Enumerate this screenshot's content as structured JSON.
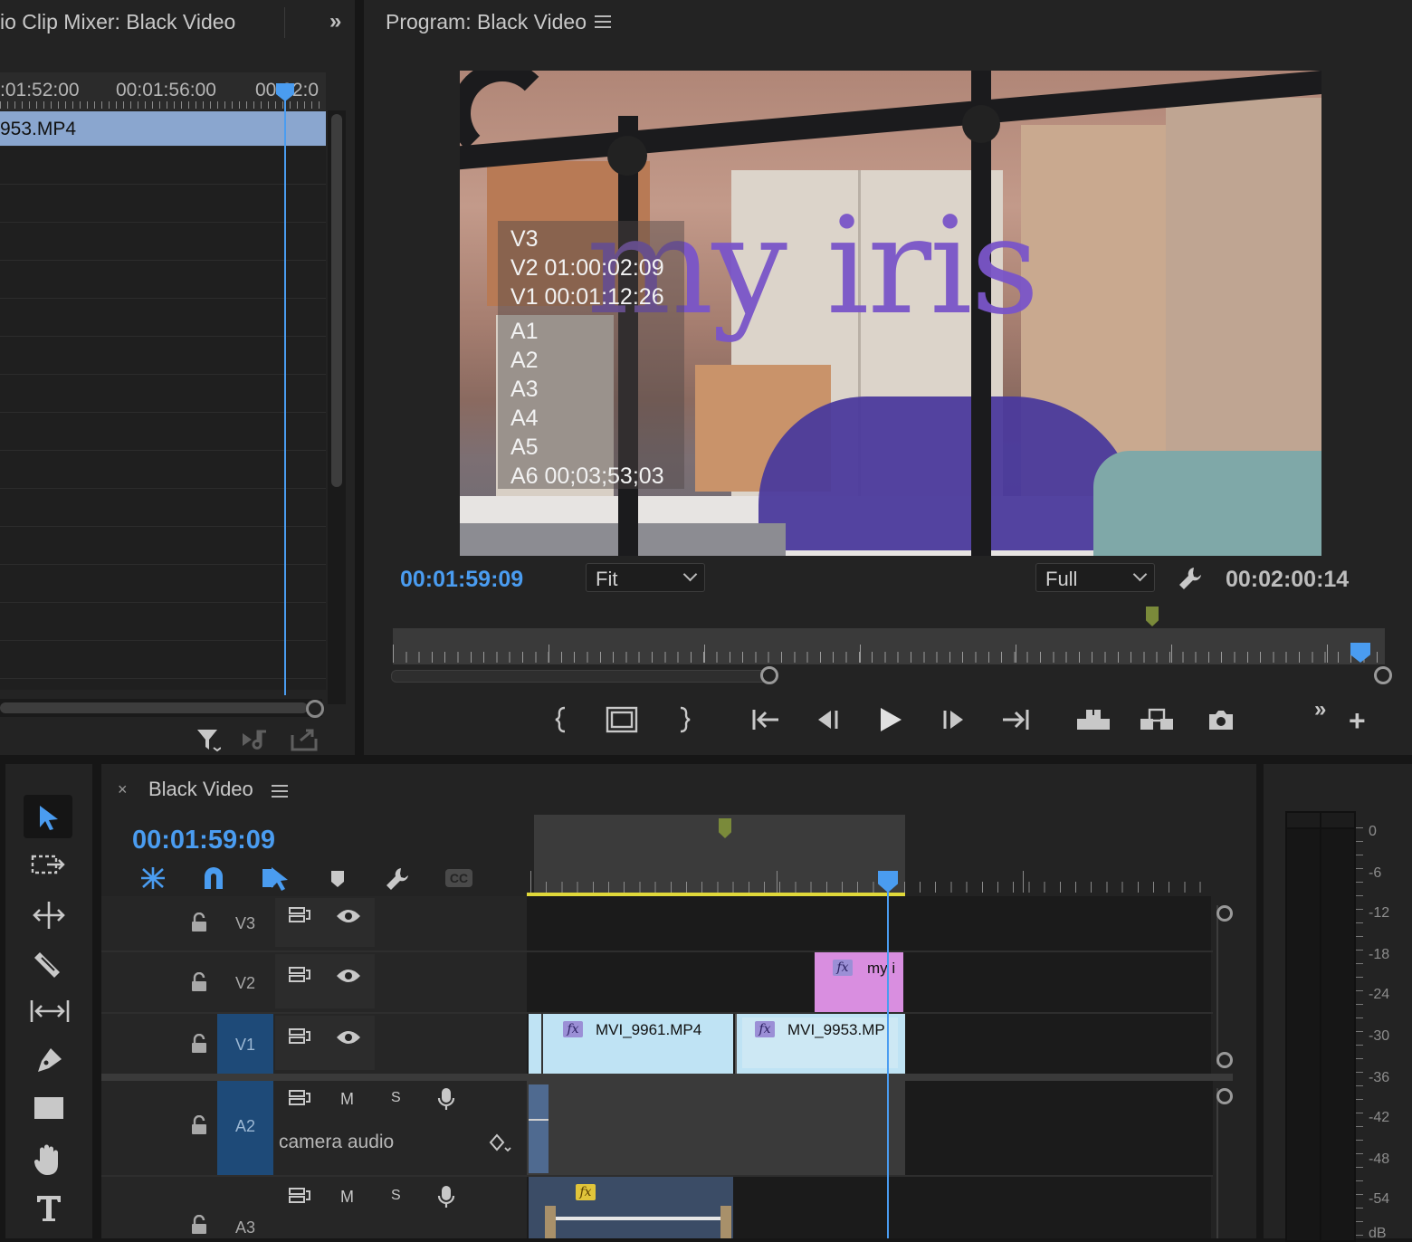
{
  "clip_mixer": {
    "title": "io Clip Mixer: Black Video",
    "ruler_times": [
      ":01:52:00",
      "00:01:56:00",
      "00:02:0"
    ],
    "clip_label": "953.MP4"
  },
  "program": {
    "title": "Program: Black Video",
    "overlay_title": "my iris",
    "overlay_lines": [
      "V3",
      "V2 01:00:02:09",
      "V1 00:01:12:26",
      "A1",
      "A2",
      "A3",
      "A4",
      "A5",
      "A6 00;03;53;03"
    ],
    "current_time": "00:01:59:09",
    "fit_label": "Fit",
    "quality_label": "Full",
    "duration": "00:02:00:14"
  },
  "timeline": {
    "title": "Black Video",
    "current_time": "00:01:59:09",
    "cc_label": "CC",
    "tracks": {
      "v3": "V3",
      "v2": "V2",
      "v1": "V1",
      "a2": "A2",
      "a3": "A3"
    },
    "audio_m": "M",
    "audio_s": "S",
    "a2_name": "camera audio",
    "clips": {
      "v2": "my i",
      "v1_a": "MVI_9961.MP4",
      "v1_b": "MVI_9953.MP"
    },
    "fx_label": "fx"
  },
  "meter": {
    "labels": [
      "0",
      "-6",
      "-12",
      "-18",
      "-24",
      "-30",
      "-36",
      "-42",
      "-48",
      "-54",
      "dB"
    ]
  },
  "colors": {
    "accent_blue": "#4a9cf0",
    "clip_v1": "#bfe3f4",
    "clip_v2": "#d98ee0",
    "clip_audio": "#3b4c66",
    "work_area": "#e0d83a",
    "title_purple": "#7a55c8"
  }
}
